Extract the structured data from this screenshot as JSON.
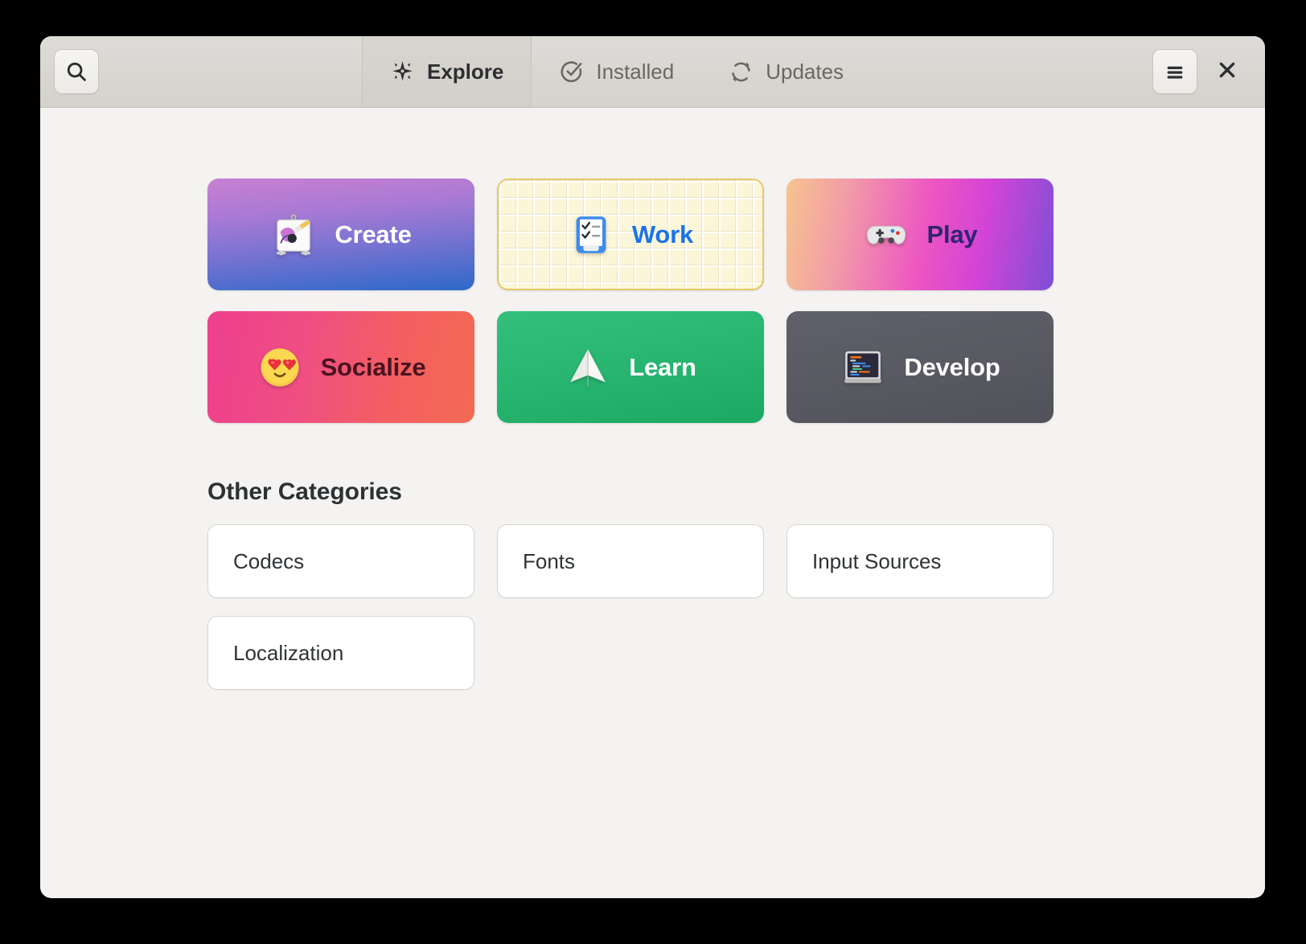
{
  "window": {
    "title": "Software",
    "background_color": "#f4f3f1",
    "header_color": "#d9d6d2"
  },
  "header": {
    "search_button": {
      "name": "Search",
      "icon": "search-icon"
    },
    "menu_button": {
      "name": "Main Menu",
      "icon": "hamburger-menu-icon"
    },
    "close_button": {
      "name": "Close",
      "icon": "close-icon"
    },
    "tabs": [
      {
        "label": "Explore",
        "icon": "explore-sparkle-icon",
        "active": true
      },
      {
        "label": "Installed",
        "icon": "installed-check-icon",
        "active": false
      },
      {
        "label": "Updates",
        "icon": "updates-refresh-icon",
        "active": false
      }
    ]
  },
  "main": {
    "featured_categories": [
      {
        "label": "Create",
        "icon": "easel-paintbrush-icon",
        "text_color": "#ffffff",
        "accent": "#2d69c9"
      },
      {
        "label": "Work",
        "icon": "clipboard-checklist-icon",
        "text_color": "#1a73e8",
        "accent": "#e9c96a"
      },
      {
        "label": "Play",
        "icon": "game-controller-icon",
        "text_color": "#2f2470",
        "accent": "#ec55c2"
      },
      {
        "label": "Socialize",
        "icon": "smiling-face-with-hearts-icon",
        "text_color": "#4a1320",
        "accent": "#ed3f8e"
      },
      {
        "label": "Learn",
        "icon": "paper-airplane-icon",
        "text_color": "#ffffff",
        "accent": "#26b46f"
      },
      {
        "label": "Develop",
        "icon": "code-terminal-icon",
        "text_color": "#ffffff",
        "accent": "#585861"
      }
    ],
    "other_categories_title": "Other Categories",
    "other_categories": [
      {
        "label": "Codecs"
      },
      {
        "label": "Fonts"
      },
      {
        "label": "Input Sources"
      },
      {
        "label": "Localization"
      }
    ]
  }
}
